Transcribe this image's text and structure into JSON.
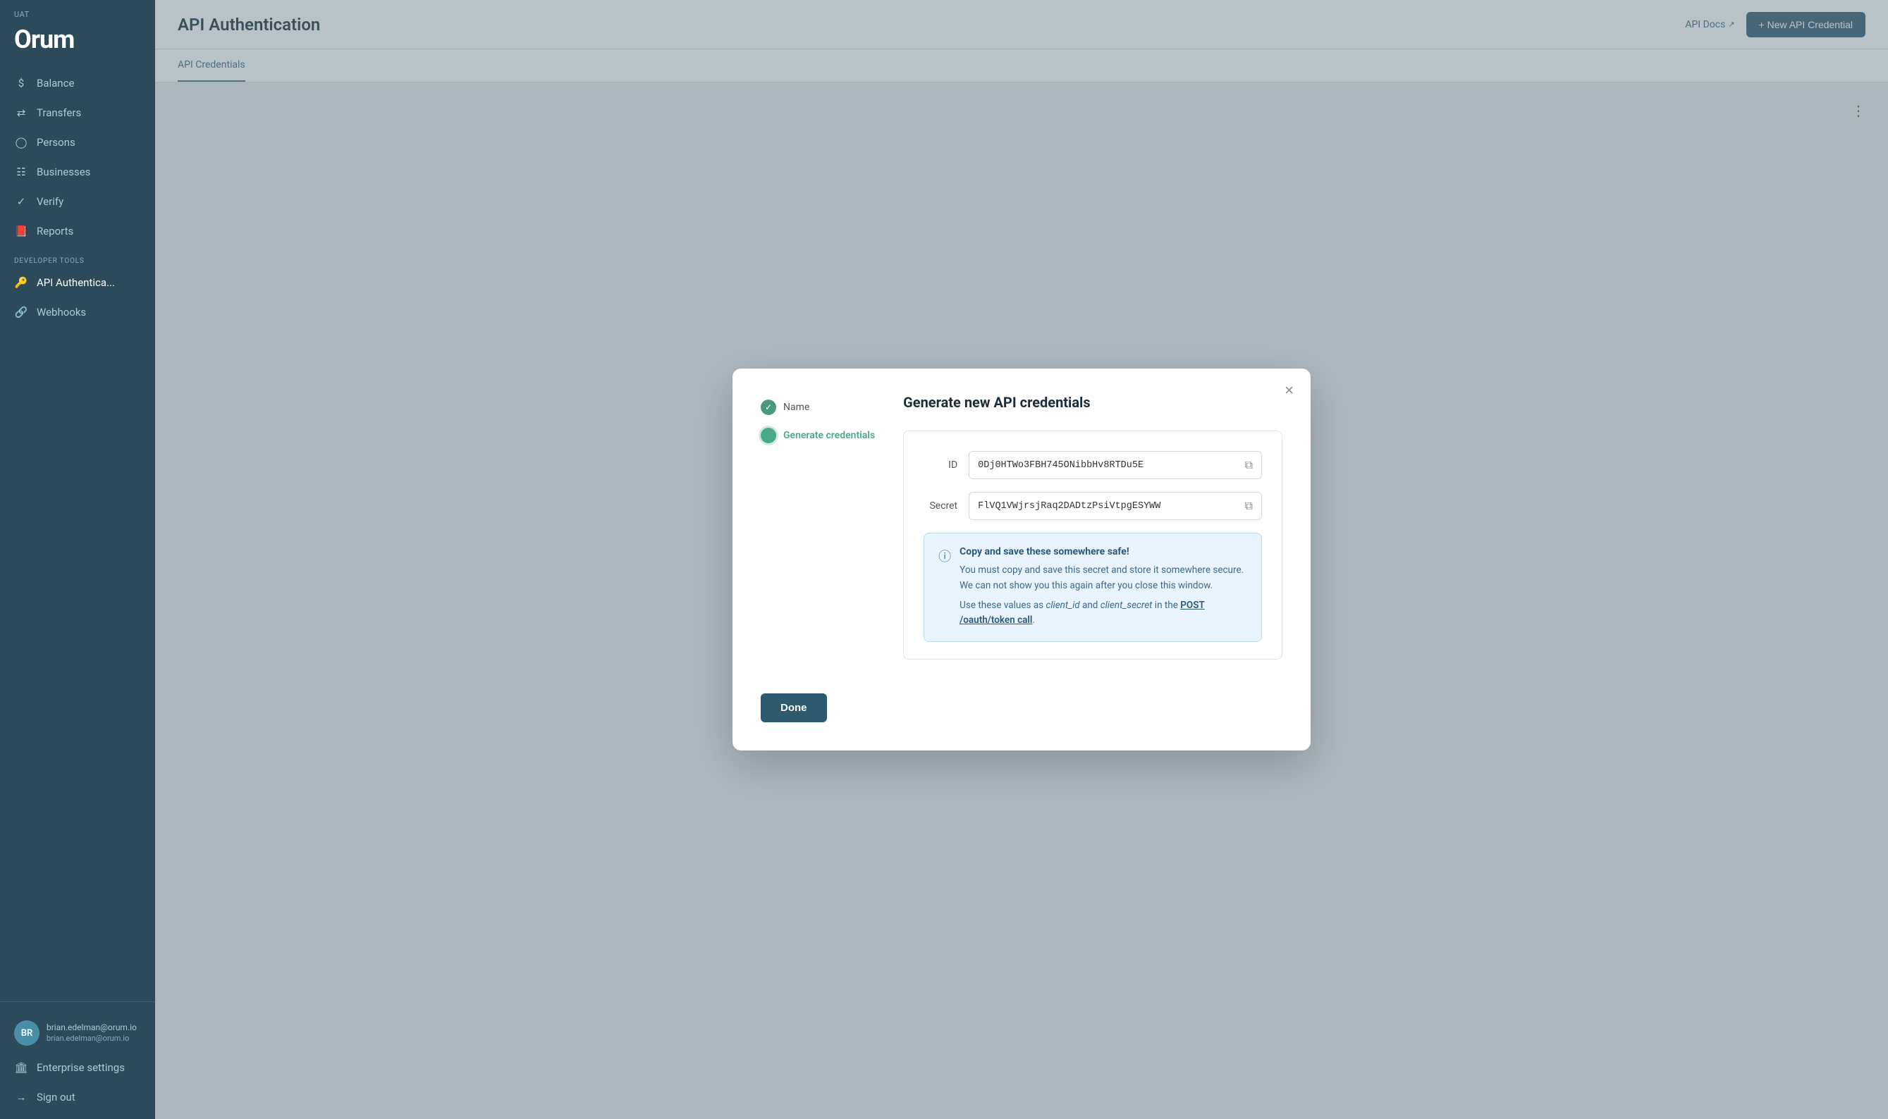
{
  "env": "UAT",
  "logo": "Orum",
  "sidebar": {
    "nav_items": [
      {
        "id": "balance",
        "label": "Balance",
        "icon": "dollar"
      },
      {
        "id": "transfers",
        "label": "Transfers",
        "icon": "transfer"
      },
      {
        "id": "persons",
        "label": "Persons",
        "icon": "person"
      },
      {
        "id": "businesses",
        "label": "Businesses",
        "icon": "business"
      },
      {
        "id": "verify",
        "label": "Verify",
        "icon": "verify"
      },
      {
        "id": "reports",
        "label": "Reports",
        "icon": "reports"
      }
    ],
    "dev_section_label": "DEVELOPER TOOLS",
    "dev_items": [
      {
        "id": "api-auth",
        "label": "API Authentica...",
        "icon": "key",
        "active": true
      },
      {
        "id": "webhooks",
        "label": "Webhooks",
        "icon": "webhook"
      }
    ],
    "user": {
      "initials": "BR",
      "name": "brian.edelman@orum.io",
      "email": "brian.edelman@orum.io"
    },
    "bottom_items": [
      {
        "id": "enterprise-settings",
        "label": "Enterprise settings",
        "icon": "building"
      },
      {
        "id": "sign-out",
        "label": "Sign out",
        "icon": "signout"
      }
    ]
  },
  "page": {
    "title": "API Authentication",
    "api_docs_label": "API Docs",
    "new_credential_label": "+ New API Credential",
    "tabs": [
      {
        "id": "api-credentials",
        "label": "API Credentials",
        "active": true
      }
    ]
  },
  "modal": {
    "title": "Generate new API credentials",
    "close_label": "×",
    "steps": [
      {
        "id": "name",
        "label": "Name",
        "state": "done"
      },
      {
        "id": "generate",
        "label": "Generate credentials",
        "state": "active"
      }
    ],
    "id_label": "ID",
    "id_value": "0Dj0HTWo3FBH745ONibbHv8RTDu5E",
    "secret_label": "Secret",
    "secret_value": "FlVQ1VWjrsjRaq2DADtzPsiVtpgESYWW",
    "info_title": "Copy and save these somewhere safe!",
    "info_text1": "You must copy and save this secret and store it somewhere secure. We can not show you this again after you close this window.",
    "info_text2_prefix": "Use these values as ",
    "info_text2_client_id": "client_id",
    "info_text2_and": " and ",
    "info_text2_client_secret": "client_secret",
    "info_text2_middle": " in the ",
    "info_text2_link": "POST /oauth/token call",
    "info_text2_suffix": ".",
    "done_label": "Done"
  }
}
